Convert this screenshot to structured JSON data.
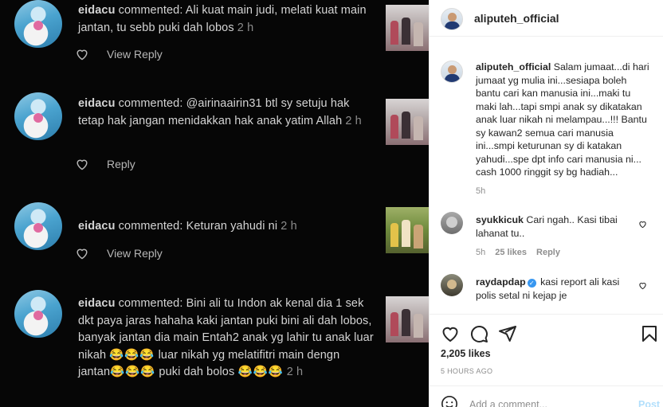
{
  "photo": {
    "notifications": [
      {
        "user": "eidacu",
        "text": " commented: Ali kuat main judi, melati kuat main jantan, tu sebb puki dah lobos",
        "time": " 2 h",
        "action": "View Reply"
      },
      {
        "user": "eidacu",
        "text": " commented: @airinaairin31 btl sy setuju hak tetap hak jangan menidakkan hak anak yatim Allah",
        "time": " 2 h",
        "action": "Reply"
      },
      {
        "user": "eidacu",
        "text": " commented: Keturan yahudi ni",
        "time": " 2 h",
        "action": "View Reply"
      },
      {
        "user": "eidacu",
        "text": " commented: Bini ali tu Indon ak kenal dia 1 sek dkt paya jaras hahaha kaki jantan puki bini ali dah lobos, banyak jantan dia main Entah2 anak yg lahir tu anak luar nikah ",
        "emoji1": "😂😂😂",
        "text2": " luar nikah yg melatifitri main dengn jantan",
        "emoji2": "😂😂😂",
        "text3": " puki dah bolos ",
        "emoji3": "😂😂😂",
        "time": " 2 h"
      }
    ]
  },
  "panel": {
    "header_username": "aliputeh_official",
    "caption": {
      "username": "aliputeh_official",
      "text": " Salam jumaat...di hari jumaat yg mulia ini...sesiapa boleh bantu cari kan manusia ini...maki tu maki lah...tapi smpi anak sy dikatakan anak luar nikah ni melampau...!!! Bantu sy kawan2 semua cari manusia ini...smpi keturunan sy di katakan yahudi...spe dpt info cari manusia ni... cash 1000 ringgit sy bg hadiah...",
      "time": "5h"
    },
    "comments": [
      {
        "username": "syukkicuk",
        "text": " Cari ngah.. Kasi tibai lahanat tu..",
        "time": "5h",
        "likes": "25 likes",
        "reply": "Reply"
      },
      {
        "username": "raydapdap",
        "verified_mark": "✓",
        "text": " kasi report ali kasi polis setal ni kejap je"
      }
    ],
    "likes_count": "2,205 likes",
    "time_ago": "5 HOURS AGO",
    "add_comment_placeholder": "Add a comment...",
    "post_label": "Post",
    "colors": {
      "accent": "#3897f0",
      "post_disabled": "#b2dffc",
      "text": "#262626",
      "muted": "#8e8e8e",
      "photo_bg": "#060606"
    },
    "icons": [
      "heart-icon",
      "comment-icon",
      "share-icon",
      "bookmark-icon",
      "emoji-icon"
    ]
  }
}
